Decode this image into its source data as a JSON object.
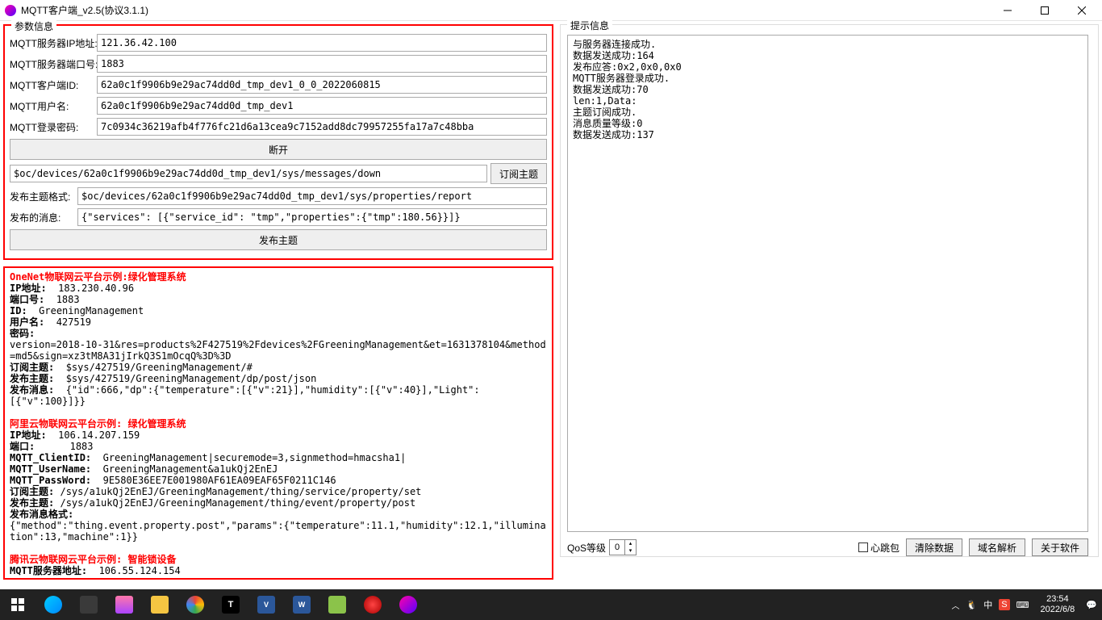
{
  "window": {
    "title": "MQTT客户端_v2.5(协议3.1.1)"
  },
  "params": {
    "legend": "参数信息",
    "server_ip_label": "MQTT服务器IP地址:",
    "server_ip": "121.36.42.100",
    "server_port_label": "MQTT服务器端口号:",
    "server_port": "1883",
    "client_id_label": "MQTT客户端ID:",
    "client_id": "62a0c1f9906b9e29ac74dd0d_tmp_dev1_0_0_2022060815",
    "username_label": "MQTT用户名:",
    "username": "62a0c1f9906b9e29ac74dd0d_tmp_dev1",
    "password_label": "MQTT登录密码:",
    "password": "7c0934c36219afb4f776fc21d6a13cea9c7152add8dc79957255fa17a7c48bba",
    "disconnect_btn": "断开",
    "subscribe_topic": "$oc/devices/62a0c1f9906b9e29ac74dd0d_tmp_dev1/sys/messages/down",
    "subscribe_btn": "订阅主题",
    "publish_fmt_label": "发布主题格式:",
    "publish_fmt": "$oc/devices/62a0c1f9906b9e29ac74dd0d_tmp_dev1/sys/properties/report",
    "publish_msg_label": "发布的消息:",
    "publish_msg": "{\"services\": [{\"service_id\": \"tmp\",\"properties\":{\"tmp\":180.56}}]}",
    "publish_btn": "发布主题"
  },
  "hints": {
    "legend": "提示信息",
    "lines": [
      "与服务器连接成功.",
      "数据发送成功:164",
      "发布应答:0x2,0x0,0x0",
      "MQTT服务器登录成功.",
      "数据发送成功:70",
      "len:1,Data:",
      "主题订阅成功.",
      "消息质量等级:0",
      "数据发送成功:137"
    ]
  },
  "bottom": {
    "qos_label": "QoS等级",
    "qos_value": "0",
    "heartbeat": "心跳包",
    "clear": "清除数据",
    "dns": "域名解析",
    "about": "关于软件"
  },
  "examples": {
    "onenet": {
      "title": "OneNet物联网云平台示例:绿化管理系统",
      "ip_label": "IP地址:",
      "ip": "183.230.40.96",
      "port_label": "端口号:",
      "port": "1883",
      "id_label": "ID:",
      "id": "GreeningManagement",
      "user_label": "用户名:",
      "user": "427519",
      "pass_label": "密码:",
      "pass": "version=2018-10-31&res=products%2F427519%2Fdevices%2FGreeningManagement&et=1631378104&method=md5&sign=xz3tM8A31jIrkQ3S1mOcqQ%3D%3D",
      "sub_label": "订阅主题:",
      "sub": "$sys/427519/GreeningManagement/#",
      "pub_label": "发布主题:",
      "pub": "$sys/427519/GreeningManagement/dp/post/json",
      "msg_label": "发布消息:",
      "msg": "{\"id\":666,\"dp\":{\"temperature\":[{\"v\":21}],\"humidity\":[{\"v\":40}],\"Light\":[{\"v\":100}]}}"
    },
    "aliyun": {
      "title": "阿里云物联网云平台示例: 绿化管理系统",
      "ip_label": "IP地址:",
      "ip": "106.14.207.159",
      "port_label": "端口:",
      "port": "1883",
      "cid_label": "MQTT_ClientID:",
      "cid": "GreeningManagement|securemode=3,signmethod=hmacsha1|",
      "un_label": "MQTT_UserName:",
      "un": "GreeningManagement&a1ukQj2EnEJ",
      "pw_label": "MQTT_PassWord:",
      "pw": "9E580E36EE7E001980AF61EA09EAF65F0211C146",
      "sub_label": "订阅主题:",
      "sub": "/sys/a1ukQj2EnEJ/GreeningManagement/thing/service/property/set",
      "pub_label": "发布主题:",
      "pub": "/sys/a1ukQj2EnEJ/GreeningManagement/thing/event/property/post",
      "fmt_label": "发布消息格式:",
      "fmt": "{\"method\":\"thing.event.property.post\",\"params\":{\"temperature\":11.1,\"humidity\":12.1,\"illumination\":13,\"machine\":1}}"
    },
    "tencent": {
      "title": "腾讯云物联网云平台示例: 智能锁设备",
      "ip_label": "MQTT服务器地址:",
      "ip": "106.55.124.154"
    }
  },
  "taskbar": {
    "time": "23:54",
    "date": "2022/6/8",
    "ime_cn": "中"
  }
}
